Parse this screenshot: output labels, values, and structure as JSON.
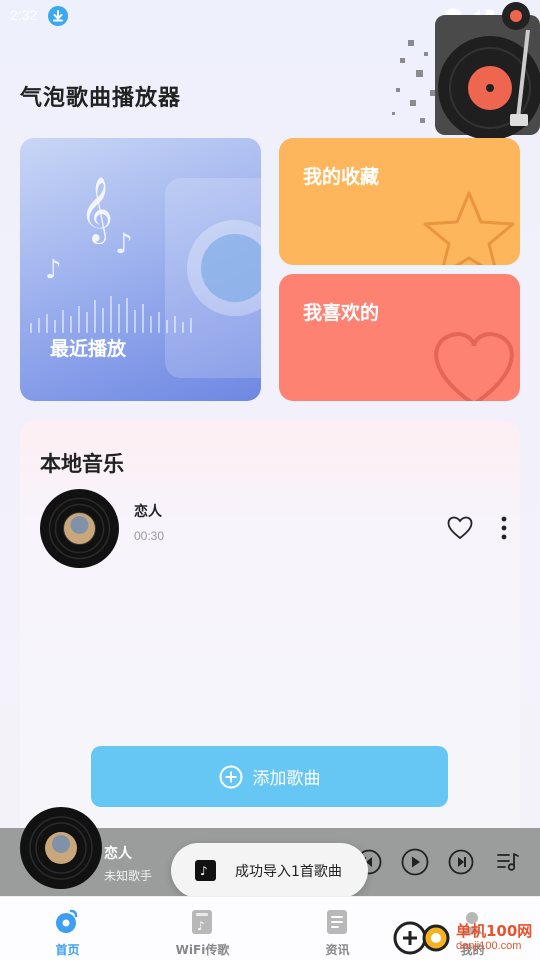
{
  "status_bar": {
    "time": "2:32"
  },
  "app": {
    "title": "气泡歌曲播放器"
  },
  "cards": {
    "recent_label": "最近播放",
    "favorites_label": "我的收藏",
    "liked_label": "我喜欢的"
  },
  "local_music": {
    "title": "本地音乐",
    "songs": [
      {
        "name": "恋人",
        "duration": "00:30"
      }
    ],
    "add_button_label": "添加歌曲"
  },
  "player": {
    "song": "恋人",
    "artist": "未知歌手"
  },
  "toast": {
    "text": "成功导入1首歌曲"
  },
  "tabs": [
    {
      "label": "首页",
      "icon": "home-disc-icon",
      "active": true
    },
    {
      "label": "WiFi传歌",
      "icon": "music-file-icon",
      "active": false
    },
    {
      "label": "资讯",
      "icon": "document-icon",
      "active": false
    },
    {
      "label": "我的",
      "icon": "profile-icon",
      "active": false
    }
  ],
  "watermark": {
    "text": "单机100网",
    "url": "danji100.com"
  },
  "colors": {
    "favorites_card": "#fdb65c",
    "liked_card": "#fd8272",
    "add_button": "#66c7f4",
    "tab_active": "#3d9ff0",
    "player_bar": "#9b9d9c"
  }
}
